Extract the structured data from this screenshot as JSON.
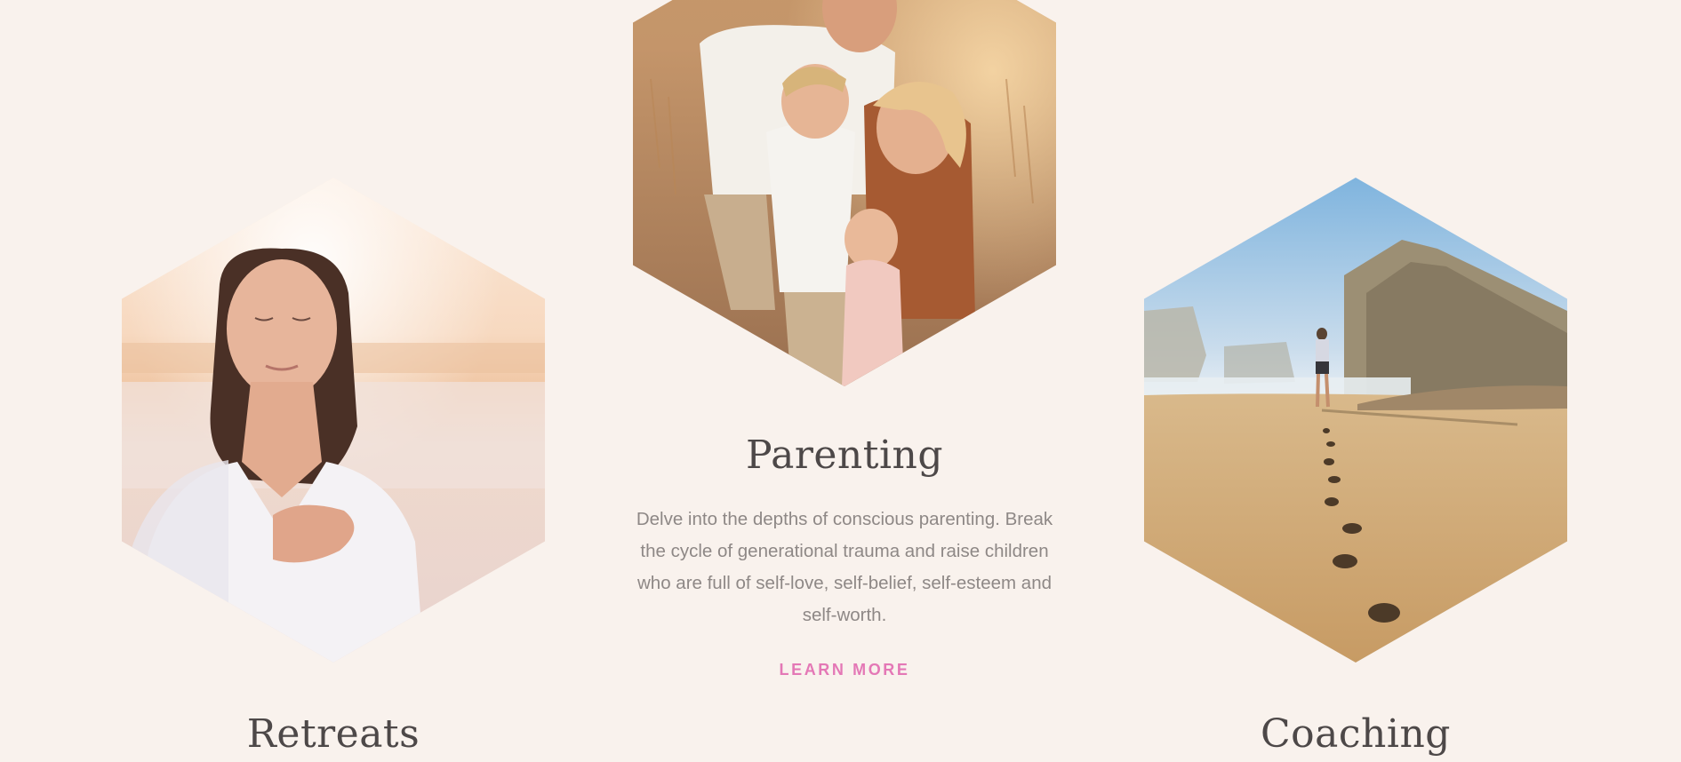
{
  "services": {
    "parenting": {
      "image_alt": "Family of four hugging in a golden field at sunset",
      "title": "Parenting",
      "description": "Delve into the depths of conscious parenting. Break the cycle of generational trauma and raise children who are full of self-love, self-belief, self-esteem and self-worth.",
      "cta": "LEARN MORE"
    },
    "retreats": {
      "image_alt": "Woman with eyes closed and hand on chest at a sunlit beach",
      "title": "Retreats"
    },
    "coaching": {
      "image_alt": "Person walking along a sandy beach leaving footprints beside cliffs",
      "title": "Coaching"
    }
  },
  "colors": {
    "background": "#f9f2ed",
    "heading": "#4d4848",
    "body_text": "#8e8886",
    "accent": "#e478b6"
  }
}
